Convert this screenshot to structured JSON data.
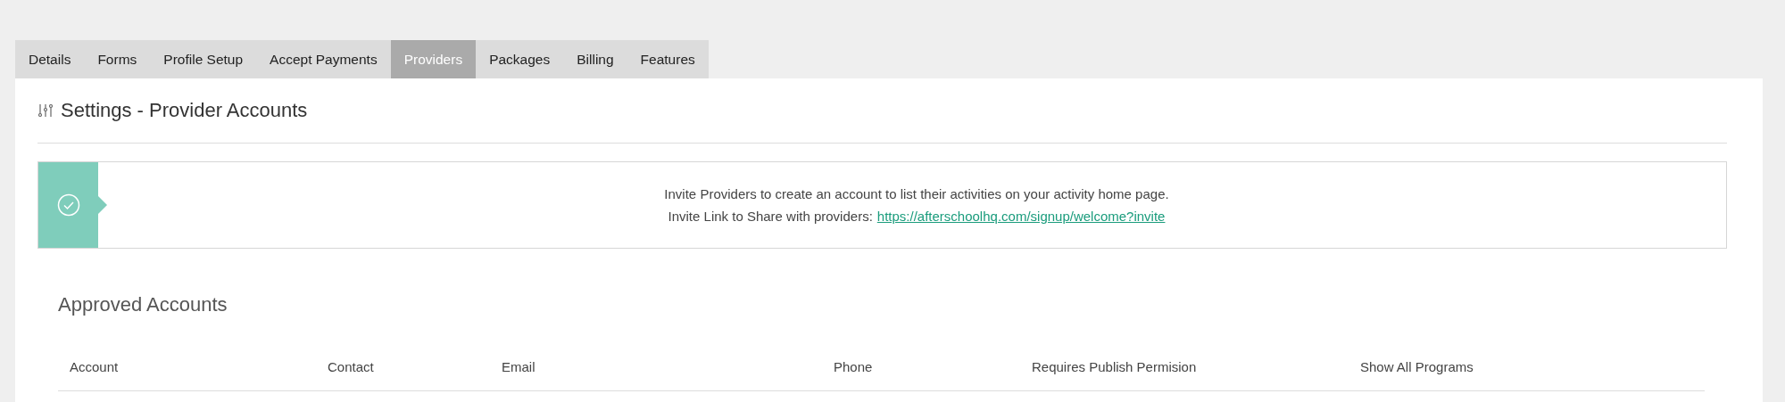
{
  "tabs": [
    {
      "label": "Details",
      "selected": false
    },
    {
      "label": "Forms",
      "selected": false
    },
    {
      "label": "Profile Setup",
      "selected": false
    },
    {
      "label": "Accept Payments",
      "selected": false
    },
    {
      "label": "Providers",
      "selected": true
    },
    {
      "label": "Packages",
      "selected": false
    },
    {
      "label": "Billing",
      "selected": false
    },
    {
      "label": "Features",
      "selected": false
    }
  ],
  "page_title": "Settings - Provider Accounts",
  "banner": {
    "message": "Invite Providers to create an account to list their activities on your activity home page.",
    "link_label": "Invite Link to Share with providers:",
    "link": "https://afterschoolhq.com/signup/welcome?invite"
  },
  "section_title": "Approved Accounts",
  "table": {
    "columns": [
      "Account",
      "Contact",
      "Email",
      "Phone",
      "Requires Publish Permision",
      "Show All Programs"
    ]
  }
}
